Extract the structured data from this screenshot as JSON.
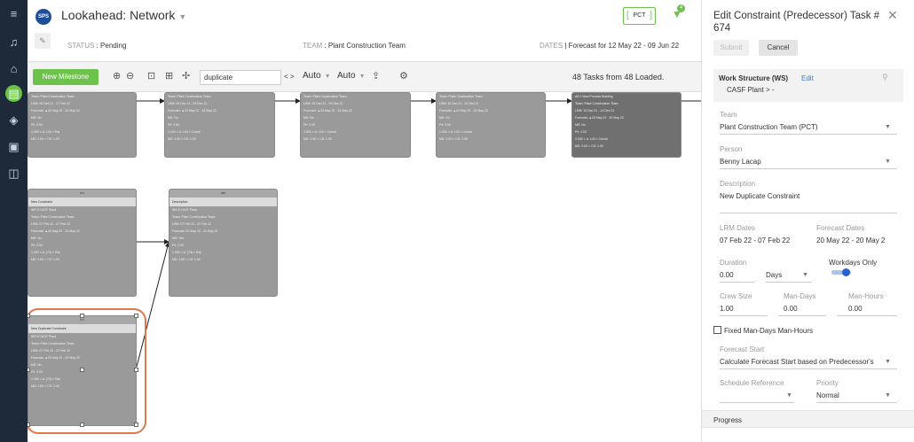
{
  "header": {
    "logo": "SPS",
    "title": "Lookahead: Network",
    "status_label": "STATUS",
    "status_value": "Pending",
    "team_label": "TEAM",
    "team_value": "Plant Construction Team",
    "dates_label": "DATES",
    "dates_value": "Forecast for 12 May 22 - 09 Jun 22",
    "pct_button": "PCT",
    "filter_count": "4"
  },
  "toolbar": {
    "new_milestone": "New Milestone",
    "search_value": "duplicate",
    "nav": "< >",
    "auto1": "Auto",
    "auto2": "Auto",
    "loaded": "48 Tasks from 48 Loaded."
  },
  "nodes": [
    {
      "lines": [
        "Team: Plant Construction Team",
        "LRM: 09 Dec 21 - 07 Feb 22",
        "Forecast: ▲20 May 22 - 20 May 22",
        "MS: No",
        "Pri: 2.00",
        "1.000 × ∆: 143 × Rat",
        "MD: 1.00 × CS: 1.00"
      ]
    },
    {
      "lines": [
        "Team: Plant Construction Team",
        "LRM: 09 Dec 21 - 09 Dec 21",
        "Forecast: ▲23 May 22 - 23 May 22",
        "MS: No",
        "Pri: 2.00",
        "1.000 × ∆: 143 × Constr",
        "MD: 1.00 × CS: 1.00"
      ]
    },
    {
      "lines": [
        "Team: Plant Construction Team",
        "LRM: 09 Dec 21 - 09 Dec 21",
        "Forecast: ▲24 May 22 - 24 May 22",
        "MS: No",
        "Pri: 2.00",
        "1.000 × ∆: 143 × Constr",
        "MD: 1.00 × CS: 1.00"
      ]
    },
    {
      "lines": [
        "Team: Plant Construction Team",
        "LRM: 10 Dec 21 - 10 Dec 21",
        "Forecast: ▲24 May 22 - 24 May 22",
        "MS: No",
        "Pri: 2.00",
        "1.000 × ∆: 143 × Constr",
        "MD: 1.00 × CS: 1.00"
      ]
    },
    {
      "lines": [
        "AB 1 New Process Building",
        "Team: Plant Construction Team",
        "LRM: 13 Dec 21 - 14 Dec 21",
        "Forecast: ▲20 May 22 - 20 May 22",
        "MS: No",
        "Pri: 2.00",
        "2.000 × ∆: 143 × Constr",
        "MD: 2.00 × CS: 1.00"
      ]
    },
    {
      "header": "673",
      "subtitle": "New Constraint",
      "lines": [
        "WS 8 CASF Plant",
        "Team: Plant Construction Team",
        "LRM: 07 Feb 22 - 07 Feb 22",
        "Forecast: ▲20 May 22 - 20 May 22",
        "MS: No",
        "Pri: 2.00",
        "1.000 × ∆: (74) × Rat",
        "MD: 1.00 × CS: 1.00"
      ]
    },
    {
      "header": "668",
      "subtitle": "Description",
      "lines": [
        "WS 8 CASF Plant",
        "Team: Plant Construction Team",
        "LRM: 07 Feb 22 - 07 Feb 22",
        "Forecast: 20 May 22 - 20 May 22",
        "MS: Yes",
        "Pri: 2.00",
        "1.000 × ∆: (73) × Rat",
        "MD: 1.00 × CS: 1.00"
      ]
    },
    {
      "header": "674",
      "subtitle": "New Duplicate Constraint",
      "lines": [
        "WS 8 CASF Plant",
        "Team: Plant Construction Team",
        "LRM: 07 Feb 22 - 07 Feb 22",
        "Forecast: ▲20 May 22 - 20 May 22",
        "MS: No",
        "Pri: 2.00",
        "1.000 × ∆: (73) × Rat",
        "MD: 1.00 × CS: 1.00"
      ]
    }
  ],
  "panel": {
    "title": "Edit Constraint (Predecessor) Task # 674",
    "submit": "Submit",
    "cancel": "Cancel",
    "ws_label": "Work Structure (WS)",
    "ws_edit": "Edit",
    "ws_value": "CASF Plant  > -",
    "team_label": "Team",
    "team_value": "Plant Construction Team (PCT)",
    "person_label": "Person",
    "person_value": "Benny Lacap",
    "desc_label": "Description",
    "desc_value": "New Duplicate Constraint",
    "lrm_label": "LRM Dates",
    "lrm_value": "07 Feb 22 - 07 Feb 22",
    "forecast_label": "Forecast Dates",
    "forecast_value": "20 May 22 - 20 May 2",
    "duration_label": "Duration",
    "duration_value": "0.00",
    "duration_unit": "Days",
    "workdays_label": "Workdays Only",
    "crew_label": "Crew Size",
    "crew_value": "1.00",
    "mandays_label": "Man-Days",
    "mandays_value": "0.00",
    "manhours_label": "Man-Hours",
    "manhours_value": "0.00",
    "fixed_label": "Fixed Man-Days Man-Hours",
    "fstart_label": "Forecast Start",
    "fstart_value": "Calculate Forecast Start based on Predecessor's",
    "schedref_label": "Schedule Reference",
    "priority_label": "Priority",
    "priority_value": "Normal",
    "progress_label": "Progress"
  }
}
